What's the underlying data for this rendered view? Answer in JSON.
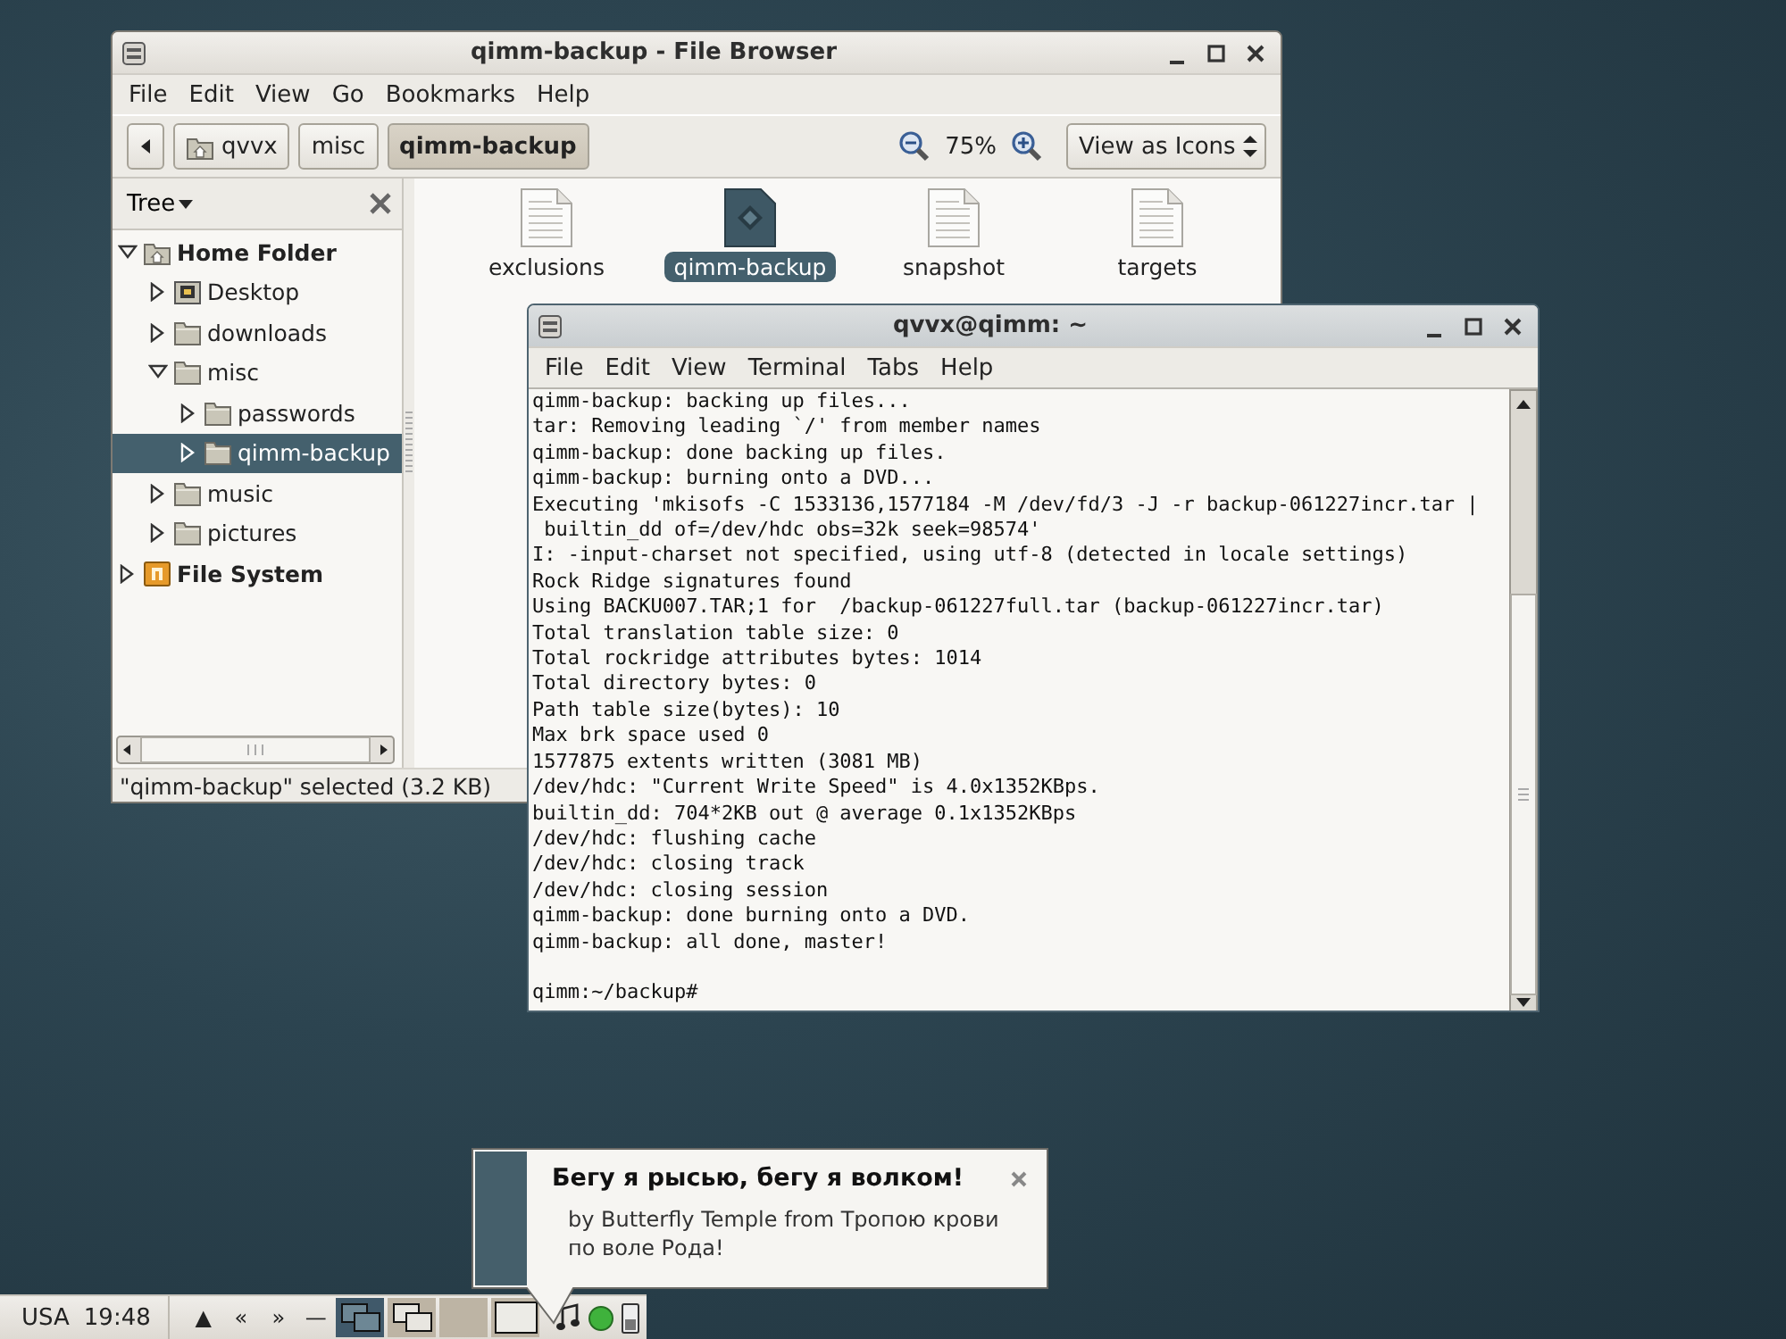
{
  "file_browser": {
    "title": "qimm-backup - File Browser",
    "menu": [
      {
        "label": "File"
      },
      {
        "label": "Edit"
      },
      {
        "label": "View"
      },
      {
        "label": "Go"
      },
      {
        "label": "Bookmarks"
      },
      {
        "label": "Help"
      }
    ],
    "path": [
      {
        "label": "qvvx",
        "kind": "home",
        "selected": false
      },
      {
        "label": "misc",
        "kind": "folder",
        "selected": false
      },
      {
        "label": "qimm-backup",
        "kind": "folder",
        "selected": true
      }
    ],
    "zoom": "75%",
    "view_mode": "View as Icons",
    "sidebar_title": "Tree",
    "tree": [
      {
        "label": "Home Folder",
        "kind": "home",
        "expanded": true,
        "selected": false,
        "children": [
          {
            "label": "Desktop",
            "kind": "desktop",
            "expanded": false,
            "selected": false
          },
          {
            "label": "downloads",
            "kind": "folder",
            "expanded": false,
            "selected": false
          },
          {
            "label": "misc",
            "kind": "folder",
            "expanded": true,
            "selected": false,
            "children": [
              {
                "label": "passwords",
                "kind": "folder",
                "expanded": false,
                "selected": false
              },
              {
                "label": "qimm-backup",
                "kind": "folder",
                "expanded": false,
                "selected": true
              }
            ]
          },
          {
            "label": "music",
            "kind": "folder",
            "expanded": false,
            "selected": false
          },
          {
            "label": "pictures",
            "kind": "folder",
            "expanded": false,
            "selected": false
          }
        ]
      },
      {
        "label": "File System",
        "kind": "drive",
        "expanded": false,
        "selected": false
      }
    ],
    "files": [
      {
        "name": "exclusions",
        "kind": "text",
        "selected": false
      },
      {
        "name": "qimm-backup",
        "kind": "script",
        "selected": true
      },
      {
        "name": "snapshot",
        "kind": "text",
        "selected": false
      },
      {
        "name": "targets",
        "kind": "text",
        "selected": false
      }
    ],
    "status": "\"qimm-backup\" selected (3.2 KB)"
  },
  "terminal": {
    "title": "qvvx@qimm: ~",
    "menu": [
      {
        "label": "File"
      },
      {
        "label": "Edit"
      },
      {
        "label": "View"
      },
      {
        "label": "Terminal"
      },
      {
        "label": "Tabs"
      },
      {
        "label": "Help"
      }
    ],
    "output": "qimm-backup: backing up files...\ntar: Removing leading `/' from member names\nqimm-backup: done backing up files.\nqimm-backup: burning onto a DVD...\nExecuting 'mkisofs -C 1533136,1577184 -M /dev/fd/3 -J -r backup-061227incr.tar |\n builtin_dd of=/dev/hdc obs=32k seek=98574'\nI: -input-charset not specified, using utf-8 (detected in locale settings)\nRock Ridge signatures found\nUsing BACKU007.TAR;1 for  /backup-061227full.tar (backup-061227incr.tar)\nTotal translation table size: 0\nTotal rockridge attributes bytes: 1014\nTotal directory bytes: 0\nPath table size(bytes): 10\nMax brk space used 0\n1577875 extents written (3081 MB)\n/dev/hdc: \"Current Write Speed\" is 4.0x1352KBps.\nbuiltin_dd: 704*2KB out @ average 0.1x1352KBps\n/dev/hdc: flushing cache\n/dev/hdc: closing track\n/dev/hdc: closing session\nqimm-backup: done burning onto a DVD.\nqimm-backup: all done, master!",
    "prompt": "qimm:~/backup#"
  },
  "notification": {
    "title": "Бегу я рысью, бегу я волком!",
    "body": "by Butterfly Temple from Тропою крови по воле Рода!"
  },
  "taskbar": {
    "keyboard": "USA",
    "clock": "19:48",
    "buttons": [
      "▲",
      "«",
      "»",
      "—"
    ],
    "workspaces": [
      {
        "kind": "two-windows",
        "selected": true
      },
      {
        "kind": "two-windows",
        "selected": false
      },
      {
        "kind": "empty",
        "selected": false
      },
      {
        "kind": "one-window",
        "selected": false
      }
    ]
  }
}
